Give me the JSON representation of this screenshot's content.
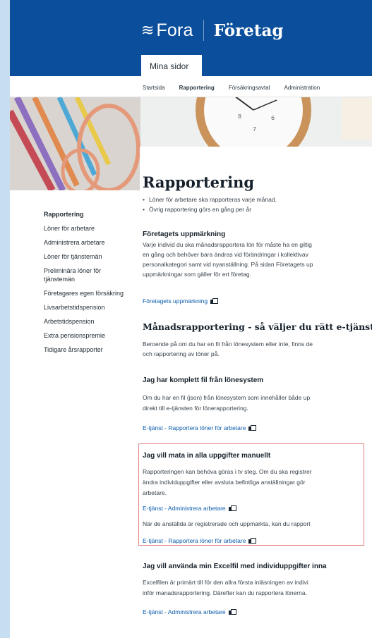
{
  "brand": {
    "fora": "Fora",
    "foretag": "Företag"
  },
  "top_tab": "Mina sidor",
  "subnav": [
    "Startsida",
    "Rapportering",
    "Försäkringsavtal",
    "Administration"
  ],
  "sidebar": {
    "items": [
      {
        "label": "Rapportering"
      },
      {
        "label": "Löner för arbetare"
      },
      {
        "label": "Administrera arbetare"
      },
      {
        "label": "Löner för tjänstemän"
      },
      {
        "label": "Preliminära löner för"
      },
      {
        "label": "tjänstemän"
      },
      {
        "label": "Företagares egen försäkring"
      },
      {
        "label": "Livsarbetstidspension"
      },
      {
        "label": "Arbetstidspension"
      },
      {
        "label": "Extra pensionspremie"
      },
      {
        "label": "Tidigare årsrapporter"
      }
    ]
  },
  "main": {
    "title": "Rapportering",
    "bullets": [
      "Löner för arbetare ska rapporteras varje månad.",
      "Övrig rapportering görs en gång per år"
    ],
    "markning": {
      "heading": "Företagets uppmärkning",
      "lines": [
        "Varje individ du ska månadsrapportera lön för måste ha en giltig",
        "en gång och behöver bara ändras vid förändringar i kollektivav",
        "personalkategori samt vid nyanställning. På sidan Företagets up",
        "uppmärkningar som gäller för ert företag."
      ],
      "link": "Företagets uppmärkning"
    },
    "manads": {
      "heading": "Månadsrapportering - så väljer du rätt e-tjänst",
      "lines": [
        "Beroende på om du har en fil från lönesystem eller inte, finns de",
        "och rapportering av löner på."
      ]
    },
    "komplett": {
      "heading": "Jag har komplett fil från lönesystem",
      "lines": [
        "Om du har en fil (json) från lönesystem som innehåller både up",
        "direkt till e-tjänsten för lönerapportering."
      ],
      "link": "E-tjänst - Rapportera löner för arbetare"
    },
    "manuellt": {
      "heading": "Jag vill mata in alla uppgifter manuellt",
      "lines": [
        "Rapporteringen kan behöva göras i tv steg. Om du ska registrer",
        "ändra individuppgifter eller avsluta befintliga anställningar gör",
        "arbetare."
      ],
      "link1": "E-tjänst - Administrera arbetare",
      "line_after": "När de anställda är registrerade och uppmärkta, kan du rapport",
      "link2": "E-tjänst - Rapportera löner för arbetare"
    },
    "excel": {
      "heading": "Jag vill använda min Excelfil med individuppgifter inna",
      "lines": [
        "Excelfilen är primärt till för den allra första inläsningen av indivi",
        "inför manadsrapportering. Därefter kan du rapportera lönerna."
      ],
      "link": "E-tjänst - Administrera arbetare"
    }
  },
  "colors": {
    "brand_blue": "#0b4f9c",
    "link_blue": "#0b5cad",
    "highlight": "#e67f7f",
    "page_bg": "#c6def0"
  },
  "icons": {
    "logo": "fora-wave-logo-icon",
    "external": "external-link-icon"
  }
}
